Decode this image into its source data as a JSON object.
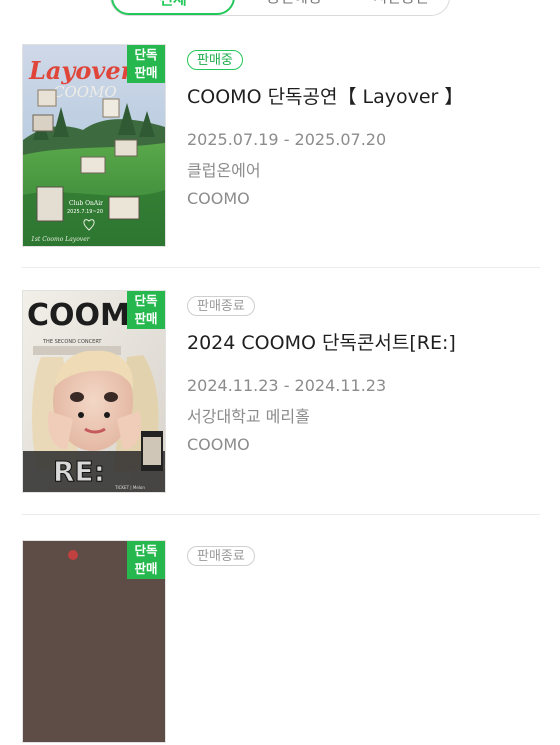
{
  "tabs": [
    {
      "label": "전체"
    },
    {
      "label": "공연예정"
    },
    {
      "label": "지난공연"
    }
  ],
  "events": [
    {
      "badge_line1": "단독",
      "badge_line2": "판매",
      "status": "판매중",
      "title": "COOMO 단독공연【 Layover 】",
      "dates": "2025.07.19 - 2025.07.20",
      "venue": "클럽온에어",
      "artist": "COOMO",
      "poster_text": "Layover",
      "poster_subtext": "COOMO",
      "poster_caption": "Club OnAir",
      "poster_date": "2025.7.19~20"
    },
    {
      "badge_line1": "단독",
      "badge_line2": "판매",
      "status": "판매종료",
      "title": "2024 COOMO 단독콘서트[RE:]",
      "dates": "2024.11.23 - 2024.11.23",
      "venue": "서강대학교 메리홀",
      "artist": "COOMO",
      "poster_text": "COOMO",
      "poster_subtext": "RE:"
    },
    {
      "badge_line1": "단독",
      "badge_line2": "판매",
      "status": "판매종료"
    }
  ],
  "colors": {
    "accent": "#24c85a",
    "badge_bg": "#26b84f",
    "muted": "#8c8c8c"
  }
}
